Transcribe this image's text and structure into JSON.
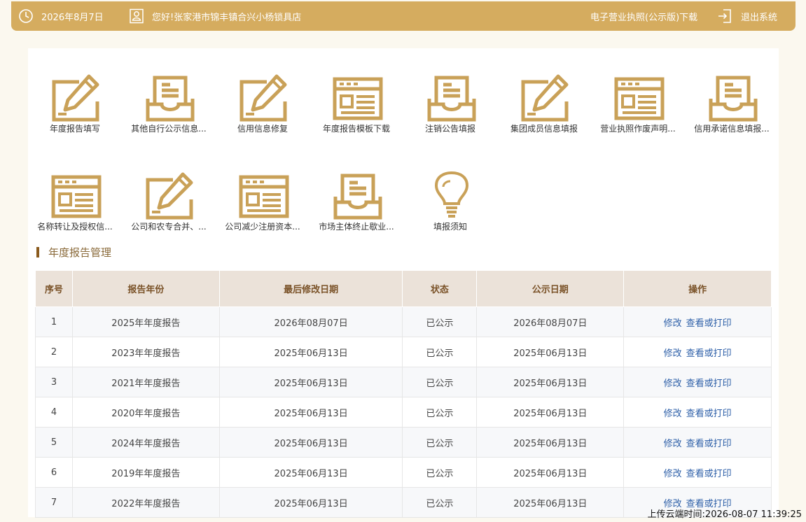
{
  "header": {
    "date": "2026年8月7日",
    "greeting": "您好!张家港市锦丰镇合兴小杨锁具店",
    "license_link": "电子营业执照(公示版)下载",
    "logout": "退出系统"
  },
  "colors": {
    "accent": "#d5ac5f",
    "icon": "#c9a158",
    "table_head": "#ebe2d9",
    "link": "#2d5fa8"
  },
  "tiles": [
    {
      "label": "年度报告填写",
      "icon": "pencil-icon"
    },
    {
      "label": "其他自行公示信息...",
      "icon": "inbox-icon"
    },
    {
      "label": "信用信息修复",
      "icon": "pencil-icon"
    },
    {
      "label": "年度报告模板下载",
      "icon": "form-icon"
    },
    {
      "label": "注销公告填报",
      "icon": "inbox-icon"
    },
    {
      "label": "集团成员信息填报",
      "icon": "pencil-icon"
    },
    {
      "label": "营业执照作废声明...",
      "icon": "form-icon"
    },
    {
      "label": "信用承诺信息填报...",
      "icon": "inbox-icon"
    },
    {
      "label": "名称转让及授权信...",
      "icon": "form-icon"
    },
    {
      "label": "公司和农专合并、...",
      "icon": "pencil-icon"
    },
    {
      "label": "公司减少注册资本...",
      "icon": "form-icon"
    },
    {
      "label": "市场主体终止歇业...",
      "icon": "inbox-icon"
    },
    {
      "label": "填报须知",
      "icon": "lightbulb-icon"
    }
  ],
  "section_title": "年度报告管理",
  "table": {
    "headers": [
      "序号",
      "报告年份",
      "最后修改日期",
      "状态",
      "公示日期",
      "操作"
    ],
    "rows": [
      [
        "1",
        "2025年年度报告",
        "2026年08月07日",
        "已公示",
        "2026年08月07日"
      ],
      [
        "2",
        "2023年年度报告",
        "2025年06月13日",
        "已公示",
        "2025年06月13日"
      ],
      [
        "3",
        "2021年年度报告",
        "2025年06月13日",
        "已公示",
        "2025年06月13日"
      ],
      [
        "4",
        "2020年年度报告",
        "2025年06月13日",
        "已公示",
        "2025年06月13日"
      ],
      [
        "5",
        "2024年年度报告",
        "2025年06月13日",
        "已公示",
        "2025年06月13日"
      ],
      [
        "6",
        "2019年年度报告",
        "2025年06月13日",
        "已公示",
        "2025年06月13日"
      ],
      [
        "7",
        "2022年年度报告",
        "2025年06月13日",
        "已公示",
        "2025年06月13日"
      ]
    ],
    "actions": {
      "edit": "修改",
      "view": "查看或打印"
    }
  },
  "footer": {
    "upload_time": "上传云端时间:2026-08-07 11:39:25"
  }
}
